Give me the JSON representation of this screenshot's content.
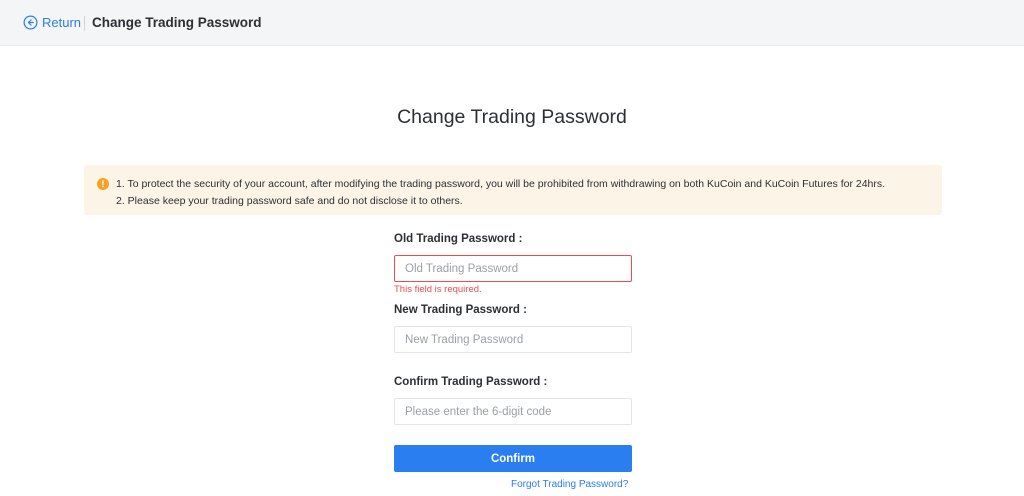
{
  "header": {
    "return_label": "Return",
    "title": "Change Trading Password"
  },
  "main": {
    "title": "Change Trading Password",
    "notice": {
      "icon": "exclamation",
      "lines": [
        "1. To protect the security of your account, after modifying the trading password, you will be prohibited from withdrawing on both KuCoin and KuCoin Futures for 24hrs.",
        "2. Please keep your trading password safe and do not disclose it to others."
      ]
    },
    "fields": [
      {
        "label": "Old Trading Password",
        "placeholder": "Old Trading Password",
        "value": "",
        "error": "This field is required."
      },
      {
        "label": "New Trading Password",
        "placeholder": "New Trading Password",
        "value": ""
      },
      {
        "label": "Confirm Trading Password",
        "placeholder": "Please enter the 6-digit code",
        "value": ""
      }
    ],
    "label_suffix": ":",
    "confirm_label": "Confirm",
    "forgot_label": "Forgot Trading Password?"
  },
  "colors": {
    "accent": "#2a7ef0",
    "error": "#e84d55",
    "warning": "#f3a227",
    "notice_bg": "#fdf4e8"
  }
}
